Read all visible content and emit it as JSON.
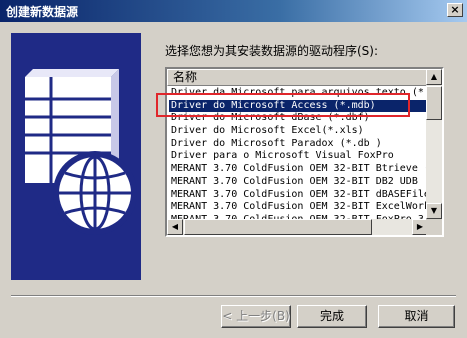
{
  "window": {
    "title": "创建新数据源",
    "close_glyph": "×"
  },
  "instruction": "选择您想为其安装数据源的驱动程序(S):",
  "list": {
    "column_header": "名称",
    "rows": [
      "Driver da Microsoft para arquivos texto (*.",
      "Driver do Microsoft Access (*.mdb)",
      "Driver do Microsoft dBase (*.dbf)",
      "Driver do Microsoft Excel(*.xls)",
      "Driver do Microsoft Paradox (*.db )",
      "Driver para o Microsoft Visual FoxPro",
      "MERANT 3.70 ColdFusion OEM 32-BIT Btrieve (",
      "MERANT 3.70 ColdFusion OEM 32-BIT DB2 UDB",
      "MERANT 3.70 ColdFusion OEM 32-BIT dBASEFile",
      "MERANT 3.70 ColdFusion OEM 32-BIT ExcelWork",
      "MERANT 3.70 ColdFusion OEM 32-BIT FoxPro 3"
    ],
    "selected_index": 1,
    "scroll_up_glyph": "▲",
    "scroll_down_glyph": "▼",
    "scroll_left_glyph": "◀",
    "scroll_right_glyph": "▶"
  },
  "buttons": {
    "back": "< 上一步(B)",
    "finish": "完成",
    "cancel": "取消"
  },
  "colors": {
    "titlebar_start": "#0a246a",
    "selection": "#0a246a",
    "highlight_box": "#e0262b",
    "art_panel": "#1f2a86"
  },
  "icons": [
    "close-icon",
    "database-globe-icon",
    "scroll-up-icon",
    "scroll-down-icon",
    "scroll-left-icon",
    "scroll-right-icon"
  ]
}
